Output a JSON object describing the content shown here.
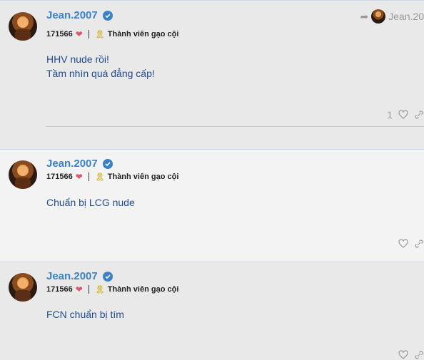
{
  "posts": [
    {
      "username": "Jean.2007",
      "score": "171566",
      "rank": "Thành viên gạo cội",
      "text_lines": [
        "HHV nude rồi!",
        "Tầm nhìn quá đẳng cấp!"
      ],
      "like_count": "1",
      "reply_to": "Jean.20"
    },
    {
      "username": "Jean.2007",
      "score": "171566",
      "rank": "Thành viên gạo cội",
      "text_lines": [
        "Chuẩn bị LCG nude"
      ],
      "like_count": ""
    },
    {
      "username": "Jean.2007",
      "score": "171566",
      "rank": "Thành viên gạo cội",
      "text_lines": [
        "FCN chuẩn bị tím"
      ],
      "like_count": ""
    }
  ],
  "icons": {
    "verified": "verified-check-icon",
    "heart": "heart-icon",
    "award": "award-icon",
    "reply": "reply-arrow-icon",
    "link": "link-icon"
  },
  "colors": {
    "username": "#3b82c4",
    "body_text": "#1f4b8e",
    "heart": "#e0556d",
    "award": "#d6b21e"
  }
}
